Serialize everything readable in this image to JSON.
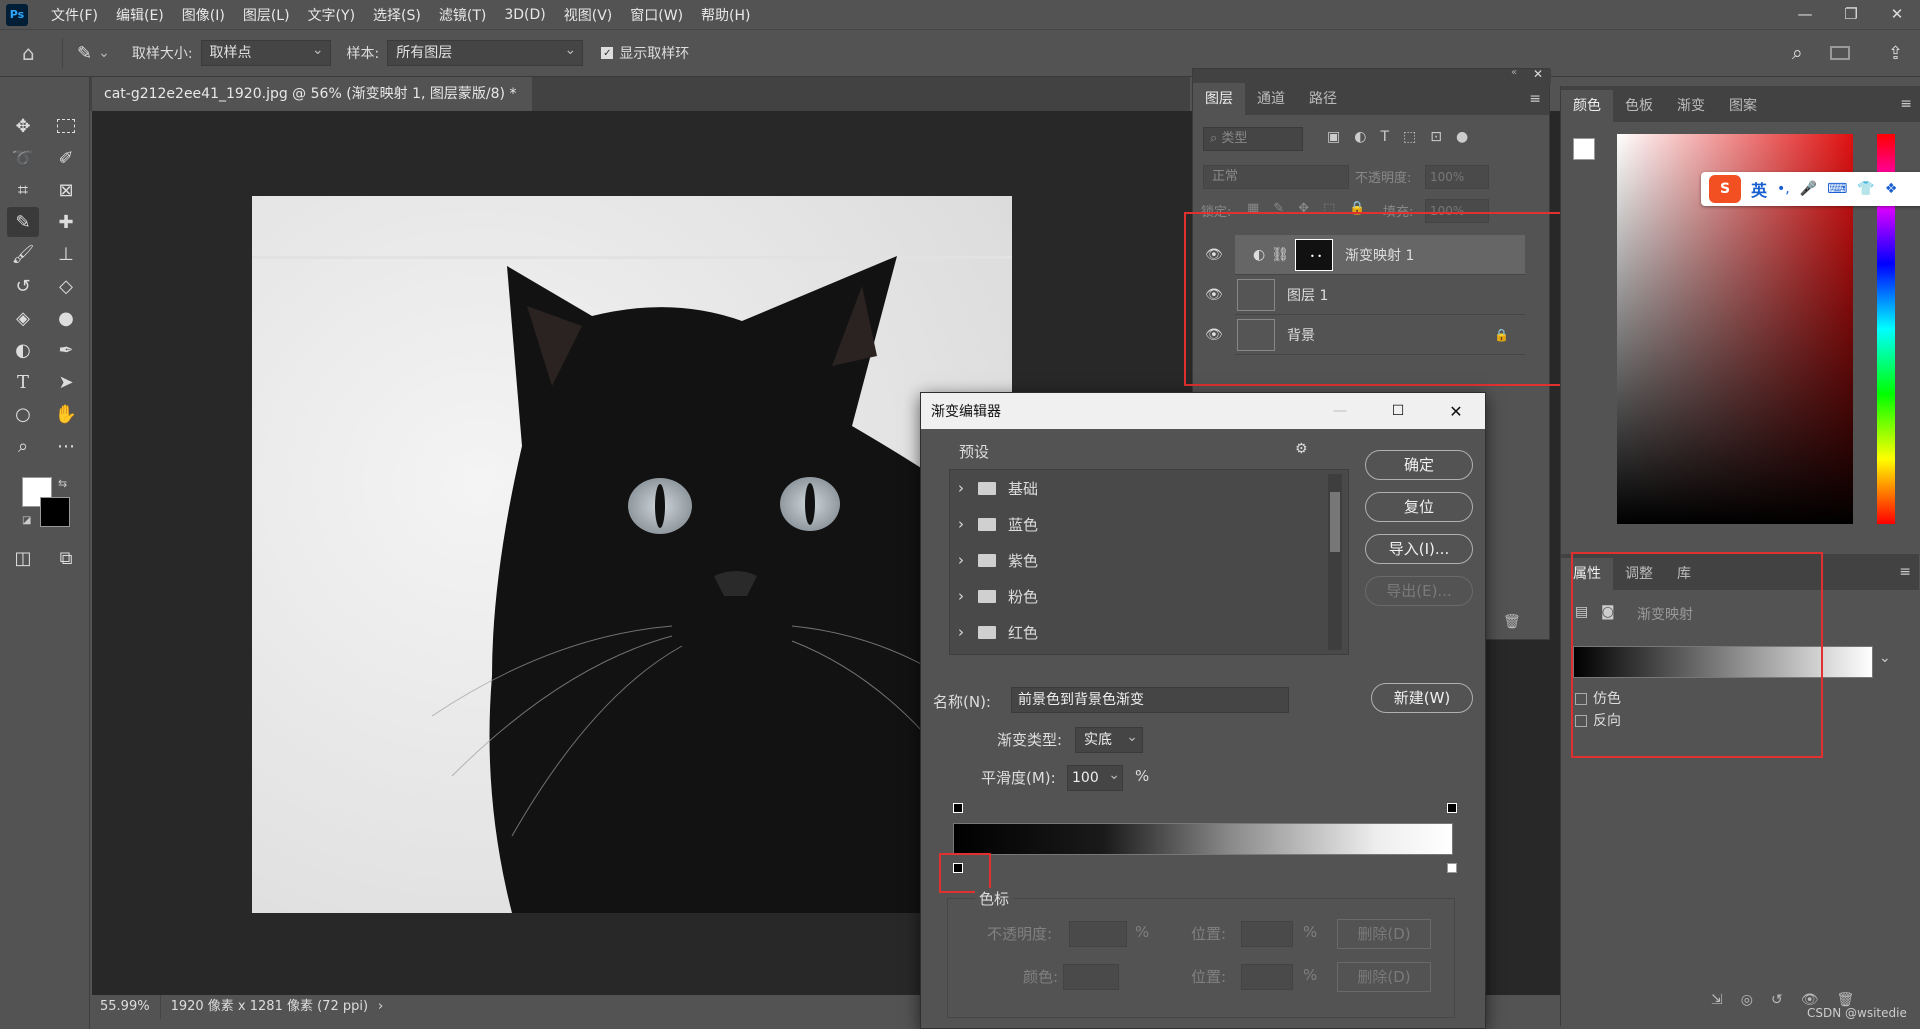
{
  "app": {
    "logo": "Ps"
  },
  "menu": [
    "文件(F)",
    "编辑(E)",
    "图像(I)",
    "图层(L)",
    "文字(Y)",
    "选择(S)",
    "滤镜(T)",
    "3D(D)",
    "视图(V)",
    "窗口(W)",
    "帮助(H)"
  ],
  "options": {
    "sample_size_label": "取样大小:",
    "sample_size_value": "取样点",
    "sample_label": "样本:",
    "sample_value": "所有图层",
    "show_ring_label": "显示取样环"
  },
  "document": {
    "tab_title": "cat-g212e2ee41_1920.jpg @ 56% (渐变映射 1, 图层蒙版/8) *",
    "close": "×"
  },
  "status": {
    "zoom": "55.99%",
    "info": "1920 像素 x 1281 像素 (72 ppi)",
    "arrow": "›"
  },
  "layers_panel": {
    "tabs": [
      "图层",
      "通道",
      "路径"
    ],
    "filter_placeholder": "类型",
    "blend_mode": "正常",
    "opacity_label": "不透明度:",
    "opacity_value": "100%",
    "lock_label": "锁定:",
    "fill_label": "填充:",
    "fill_value": "100%",
    "layers": [
      {
        "name": "渐变映射 1"
      },
      {
        "name": "图层 1"
      },
      {
        "name": "背景"
      }
    ]
  },
  "color_panel": {
    "tabs": [
      "颜色",
      "色板",
      "渐变",
      "图案"
    ]
  },
  "ime": {
    "mode": "英",
    "punct": "•,"
  },
  "properties_panel": {
    "tabs": [
      "属性",
      "调整",
      "库"
    ],
    "title": "渐变映射",
    "dither": "仿色",
    "reverse": "反向"
  },
  "gradient_editor": {
    "title": "渐变编辑器",
    "presets_label": "预设",
    "presets": [
      "基础",
      "蓝色",
      "紫色",
      "粉色",
      "红色"
    ],
    "ok": "确定",
    "reset": "复位",
    "import": "导入(I)...",
    "export": "导出(E)...",
    "name_label": "名称(N):",
    "name_value": "前景色到背景色渐变",
    "new": "新建(W)",
    "type_label": "渐变类型:",
    "type_value": "实底",
    "smooth_label": "平滑度(M):",
    "smooth_value": "100",
    "percent": "%",
    "stops_label": "色标",
    "opacity_label": "不透明度:",
    "position_label": "位置:",
    "delete": "删除(D)",
    "color_label": "颜色:"
  },
  "watermark": "CSDN @wsitedie",
  "colors": {
    "accent_red": "#e03030",
    "panel": "#535353",
    "canvas": "#282828"
  }
}
